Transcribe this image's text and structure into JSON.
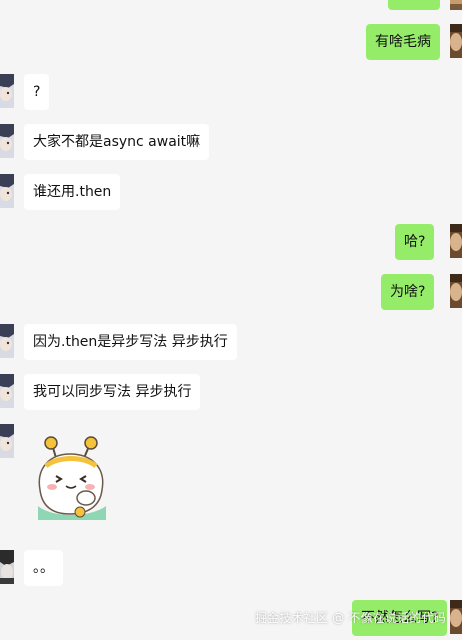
{
  "messages": [
    {
      "side": "right",
      "text": ""
    },
    {
      "side": "right",
      "text": "有啥毛病"
    },
    {
      "side": "left",
      "text": "?"
    },
    {
      "side": "left",
      "text": "大家不都是async await嘛"
    },
    {
      "side": "left",
      "text": "谁还用.then"
    },
    {
      "side": "right",
      "text": "哈?"
    },
    {
      "side": "right",
      "text": "为啥?"
    },
    {
      "side": "left",
      "text": "因为.then是异步写法 异步执行"
    },
    {
      "side": "left",
      "text": "我可以同步写法 异步执行"
    },
    {
      "side": "left",
      "sticker": "cat-bee-headband-sticker"
    },
    {
      "side": "left",
      "text": "。。"
    },
    {
      "side": "right",
      "text": "不然怎么写?"
    }
  ],
  "watermark": "掘金技术社区 @ 不像在说话的代码",
  "colors": {
    "background": "#f5f5f5",
    "incoming_bubble": "#ffffff",
    "outgoing_bubble": "#95ec69"
  }
}
